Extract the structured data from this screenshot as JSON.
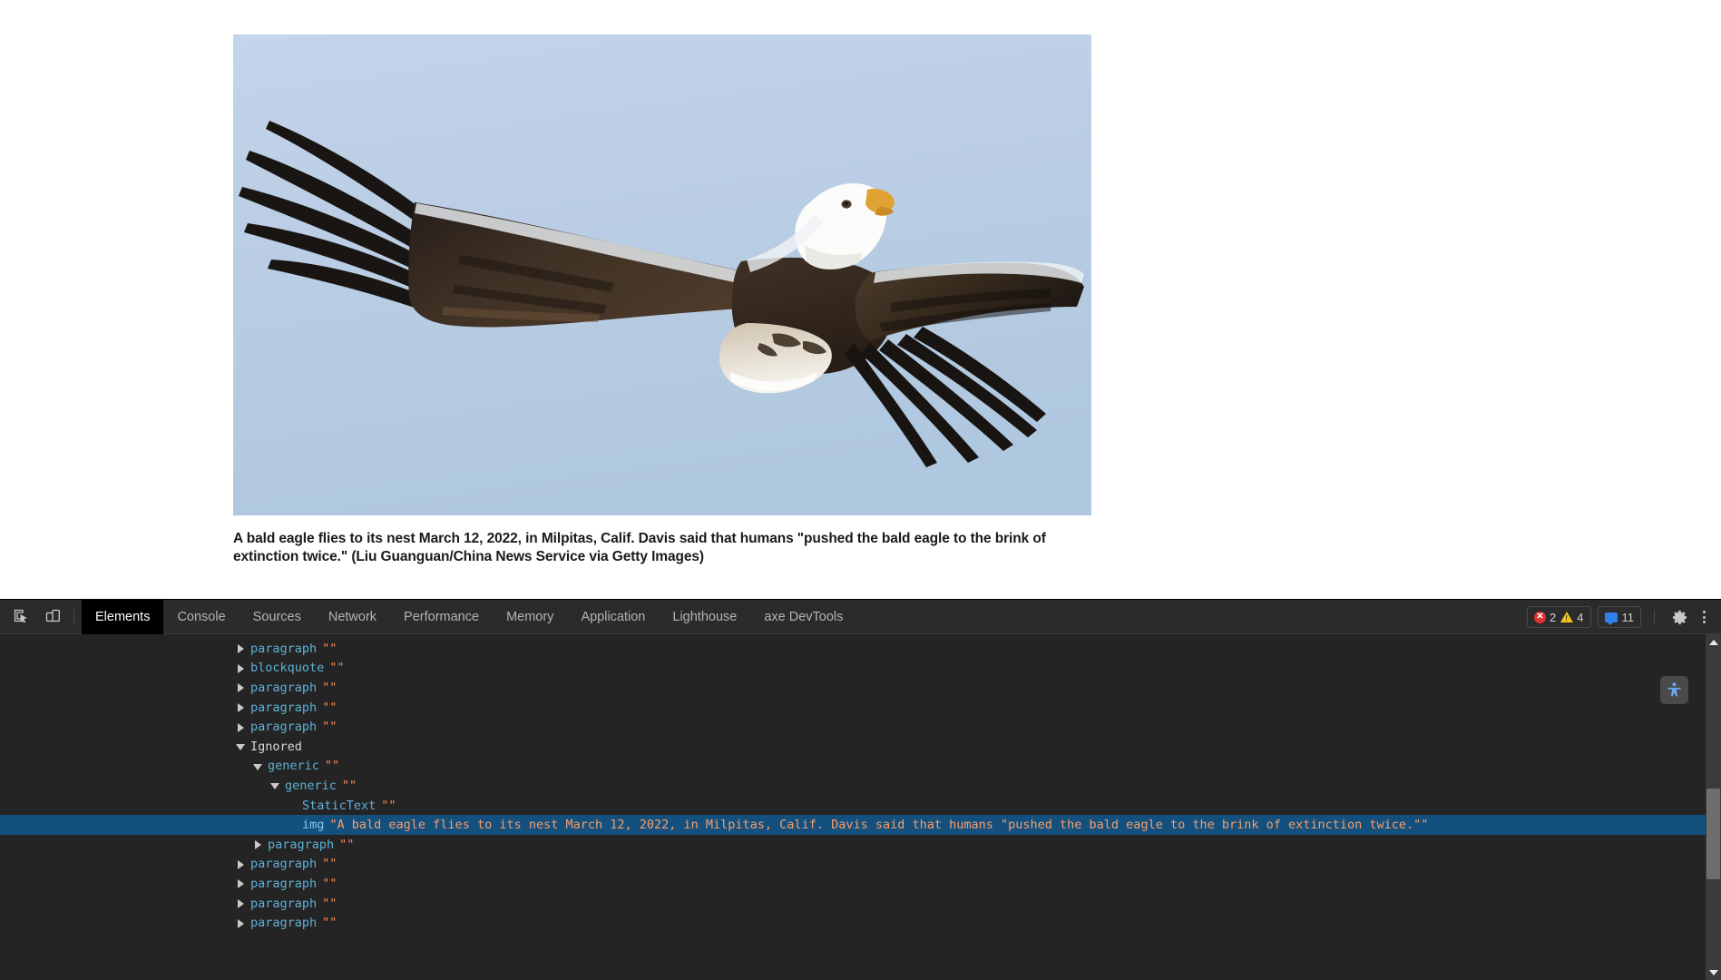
{
  "page": {
    "image_alt": "A bald eagle flies to its nest March 12, 2022, in Milpitas, Calif. Davis said that humans \"pushed the bald eagle to the brink of extinction twice.\"",
    "caption": "A bald eagle flies to its nest March 12, 2022, in Milpitas, Calif. Davis said that humans \"pushed the bald eagle to the brink of extinction twice.\" (Liu Guanguan/China News Service via Getty Images)"
  },
  "devtools": {
    "inspect_icon": "inspect-element-icon",
    "device_icon": "device-toolbar-icon",
    "tabs": [
      {
        "label": "Elements",
        "active": true
      },
      {
        "label": "Console",
        "active": false
      },
      {
        "label": "Sources",
        "active": false
      },
      {
        "label": "Network",
        "active": false
      },
      {
        "label": "Performance",
        "active": false
      },
      {
        "label": "Memory",
        "active": false
      },
      {
        "label": "Application",
        "active": false
      },
      {
        "label": "Lighthouse",
        "active": false
      },
      {
        "label": "axe DevTools",
        "active": false
      }
    ],
    "status": {
      "error_glyph": "✕",
      "error_count": "2",
      "warning_count": "4",
      "message_count": "11",
      "error_color": "#e03131",
      "warning_color": "#f2c41d",
      "message_color": "#2f80ed"
    },
    "settings_icon": "gear-icon",
    "more_icon": "kebab-menu-icon",
    "a11y_fab_icon": "accessibility-person-icon",
    "accent_selected": "#14507d",
    "role_color": "#5db0d7",
    "name_color": "#f28b54",
    "tree": [
      {
        "indent": 4,
        "arrow": "closed",
        "role": "paragraph",
        "name": "\"\"",
        "selected": false,
        "plain": false
      },
      {
        "indent": 4,
        "arrow": "closed",
        "role": "blockquote",
        "name": "\"\"",
        "selected": false,
        "plain": false
      },
      {
        "indent": 4,
        "arrow": "closed",
        "role": "paragraph",
        "name": "\"\"",
        "selected": false,
        "plain": false
      },
      {
        "indent": 4,
        "arrow": "closed",
        "role": "paragraph",
        "name": "\"\"",
        "selected": false,
        "plain": false
      },
      {
        "indent": 4,
        "arrow": "closed",
        "role": "paragraph",
        "name": "\"\"",
        "selected": false,
        "plain": false
      },
      {
        "indent": 4,
        "arrow": "open",
        "role": "Ignored",
        "name": "",
        "selected": false,
        "plain": true
      },
      {
        "indent": 5,
        "arrow": "open",
        "role": "generic",
        "name": "\"\"",
        "selected": false,
        "plain": false
      },
      {
        "indent": 6,
        "arrow": "open",
        "role": "generic",
        "name": "\"\"",
        "selected": false,
        "plain": false
      },
      {
        "indent": 7,
        "arrow": "none",
        "role": "StaticText",
        "name": "\"\"",
        "selected": false,
        "plain": false
      },
      {
        "indent": 7,
        "arrow": "none",
        "role": "img",
        "name": "\"A bald eagle flies to its nest March 12, 2022, in Milpitas, Calif. Davis said that humans \"pushed the bald eagle to the brink of extinction twice.\"\"",
        "selected": true,
        "plain": false
      },
      {
        "indent": 5,
        "arrow": "closed",
        "role": "paragraph",
        "name": "\"\"",
        "selected": false,
        "plain": false
      },
      {
        "indent": 4,
        "arrow": "closed",
        "role": "paragraph",
        "name": "\"\"",
        "selected": false,
        "plain": false
      },
      {
        "indent": 4,
        "arrow": "closed",
        "role": "paragraph",
        "name": "\"\"",
        "selected": false,
        "plain": false
      },
      {
        "indent": 4,
        "arrow": "closed",
        "role": "paragraph",
        "name": "\"\"",
        "selected": false,
        "plain": false
      },
      {
        "indent": 4,
        "arrow": "closed",
        "role": "paragraph",
        "name": "\"\"",
        "selected": false,
        "plain": false
      }
    ]
  }
}
